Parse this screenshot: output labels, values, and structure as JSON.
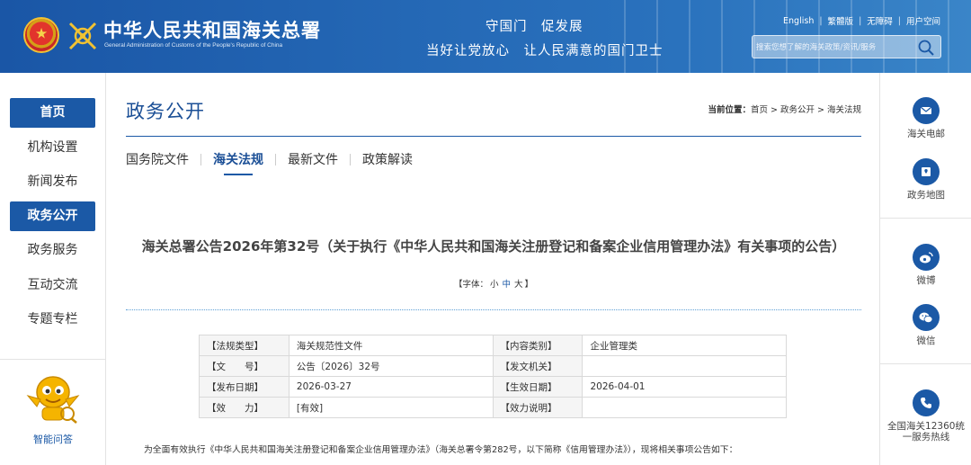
{
  "header": {
    "site_name": "中华人民共和国海关总署",
    "site_sub": "General Administration of Customs of the People's Republic of China",
    "slogan_line1": "守国门　促发展",
    "slogan_line2": "当好让党放心　让人民满意的国门卫士",
    "top_links": [
      "English",
      "繁體版",
      "无障碍",
      "用户空间"
    ],
    "search_placeholder": "搜索您想了解的海关政策/资讯/服务"
  },
  "leftnav": {
    "items": [
      {
        "label": "首页",
        "active": true
      },
      {
        "label": "机构设置",
        "active": false
      },
      {
        "label": "新闻发布",
        "active": false
      },
      {
        "label": "政务公开",
        "active": true
      },
      {
        "label": "政务服务",
        "active": false
      },
      {
        "label": "互动交流",
        "active": false
      },
      {
        "label": "专题专栏",
        "active": false
      }
    ],
    "assistant_label": "智能问答"
  },
  "main": {
    "section_title": "政务公开",
    "breadcrumb_prefix": "当前位置：",
    "breadcrumb": "首页 > 政务公开 > 海关法规",
    "tabs": [
      {
        "label": "国务院文件",
        "active": false
      },
      {
        "label": "海关法规",
        "active": true
      },
      {
        "label": "最新文件",
        "active": false
      },
      {
        "label": "政策解读",
        "active": false
      }
    ],
    "doc_title": "海关总署公告2026年第32号（关于执行《中华人民共和国海关注册登记和备案企业信用管理办法》有关事项的公告）",
    "font_size": {
      "prefix": "【字体：",
      "small": "小",
      "medium": "中",
      "large": "大",
      "suffix": "】"
    },
    "meta": [
      {
        "k1": "【法规类型】",
        "v1": "海关规范性文件",
        "k2": "【内容类别】",
        "v2": "企业管理类"
      },
      {
        "k1": "【文　　号】",
        "v1": "公告〔2026〕32号",
        "k2": "【发文机关】",
        "v2": ""
      },
      {
        "k1": "【发布日期】",
        "v1": "2026-03-27",
        "k2": "【生效日期】",
        "v2": "2026-04-01"
      },
      {
        "k1": "【效　　力】",
        "v1": "[有效]",
        "k2": "【效力说明】",
        "v2": ""
      }
    ],
    "intro": "为全面有效执行《中华人民共和国海关注册登记和备案企业信用管理办法》（海关总署令第282号，以下简称《信用管理办法》），现将相关事项公告如下："
  },
  "rightbar": {
    "items": [
      {
        "label": "海关电邮",
        "icon": "mail-icon"
      },
      {
        "label": "政务地图",
        "icon": "map-icon"
      },
      {
        "label": "微博",
        "icon": "weibo-icon"
      },
      {
        "label": "微信",
        "icon": "wechat-icon"
      },
      {
        "label": "全国海关12360统一服务热线",
        "icon": "phone-icon"
      }
    ]
  },
  "colors": {
    "primary": "#1b59a6",
    "header_bg": "#2569b6",
    "title": "#1b4f96"
  }
}
